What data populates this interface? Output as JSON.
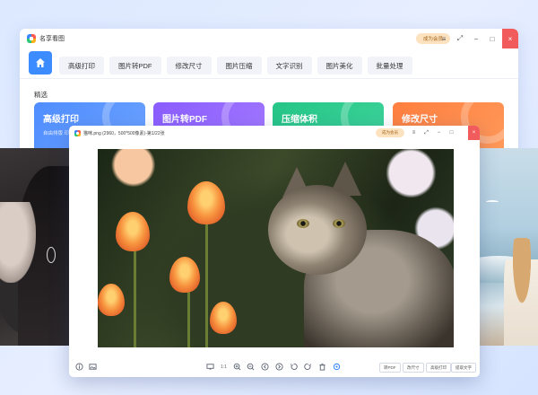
{
  "main_window": {
    "app_name": "名享看图",
    "vip_button": "成为会员",
    "controls": {
      "menu": "≡",
      "fullscreen": "⤢",
      "minimize": "−",
      "maximize": "□",
      "close": "×"
    },
    "tabs": [
      {
        "label": "高级打印"
      },
      {
        "label": "图片转PDF"
      },
      {
        "label": "修改尺寸"
      },
      {
        "label": "图片压缩"
      },
      {
        "label": "文字识别"
      },
      {
        "label": "图片美化"
      },
      {
        "label": "批量处理"
      }
    ],
    "section_title": "精选",
    "cards": [
      {
        "title": "高级打印",
        "desc": "自由排版 印，强化"
      },
      {
        "title": "图片转PDF",
        "desc": ""
      },
      {
        "title": "压缩体积",
        "desc": ""
      },
      {
        "title": "修改尺寸",
        "desc": ""
      }
    ]
  },
  "viewer": {
    "title": "猫咪.png (2960，500*500像素)-第1/22张",
    "vip_button": "成为会员",
    "controls": {
      "menu": "≡",
      "fullscreen": "⤢",
      "minimize": "−",
      "maximize": "□",
      "close": "×"
    },
    "toolbar": {
      "icons": [
        "info-icon",
        "image-icon",
        "monitor-icon",
        "actual-size-icon",
        "zoom-in-icon",
        "zoom-out-icon",
        "prev-icon",
        "next-icon",
        "rotate-left-icon",
        "rotate-right-icon",
        "delete-icon",
        "settings-icon"
      ],
      "buttons": [
        "转PDF",
        "改尺寸",
        "高级打印",
        "提取文字"
      ],
      "actual_size_label": "1:1"
    }
  },
  "colors": {
    "accent_blue": "#3c8bff",
    "close_red": "#f25b5b",
    "vip_bg": "#fde2bf",
    "card_blue": "#4f8dff",
    "card_purple": "#8a5cff",
    "card_green": "#25c587",
    "card_orange": "#ff7f3f"
  }
}
